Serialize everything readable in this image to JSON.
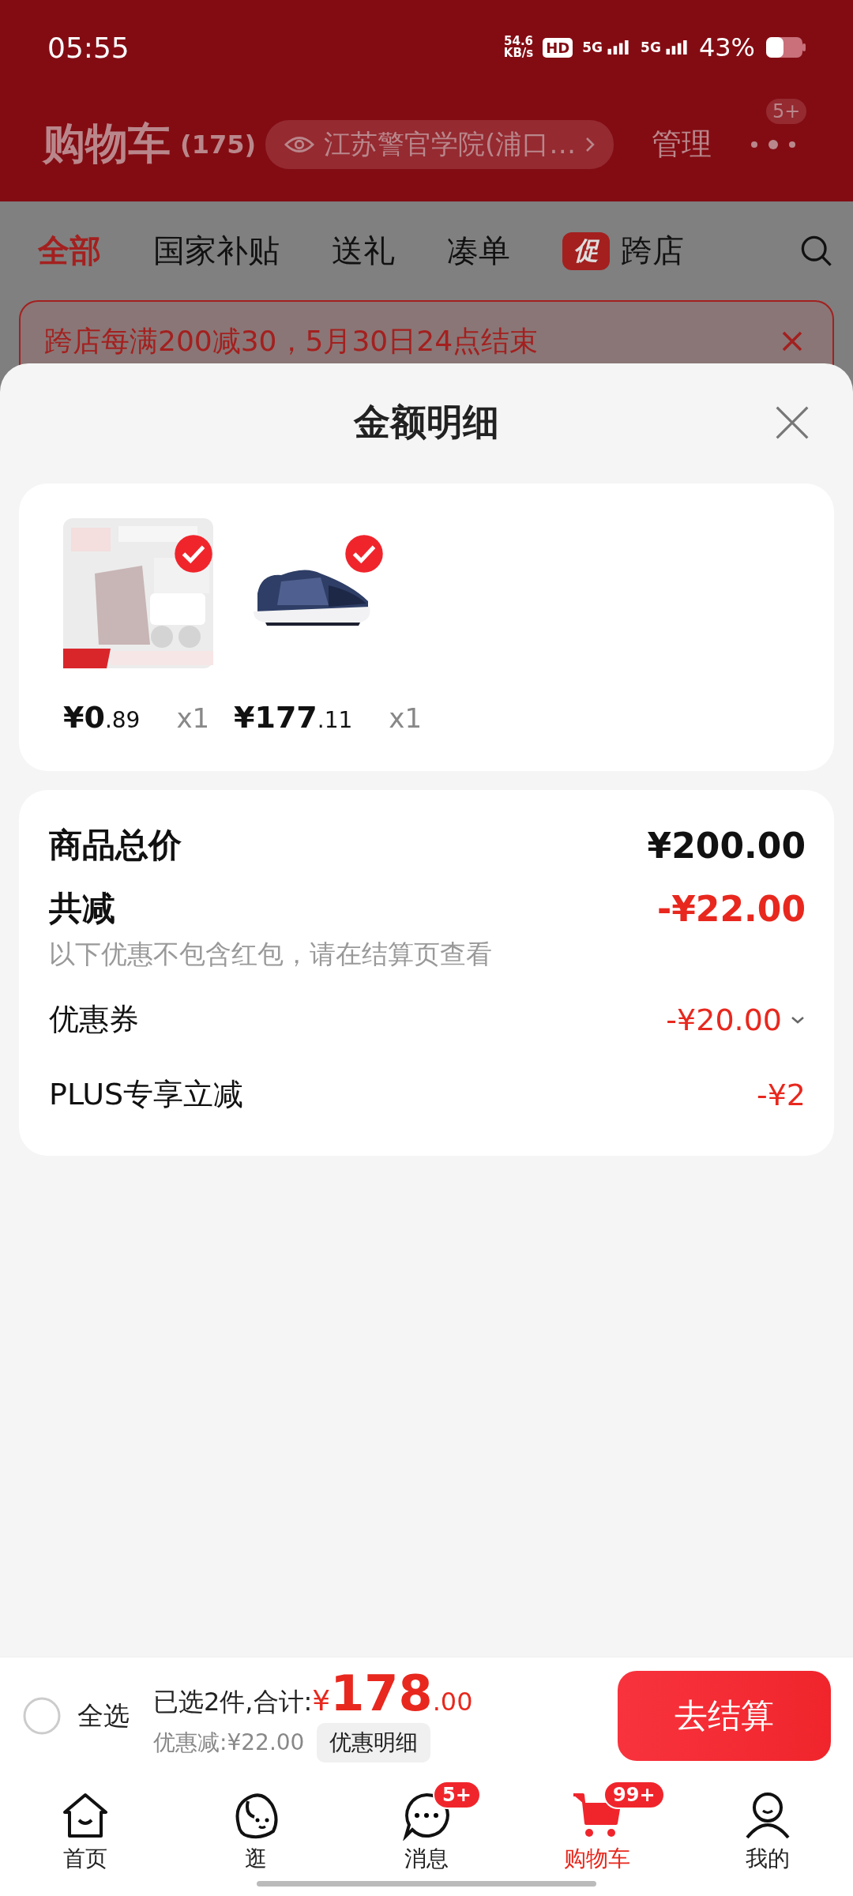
{
  "status_bar": {
    "time": "05:55",
    "net_speed": "54.6",
    "net_unit": "KB/s",
    "hd": "HD",
    "signals": [
      "5G",
      "5G"
    ],
    "battery": "43%"
  },
  "header": {
    "title": "购物车",
    "count": "(175)",
    "address": "江苏警官学院(浦口…",
    "manage": "管理",
    "more_badge": "5+"
  },
  "tabs": [
    {
      "label": "全部",
      "selected": true
    },
    {
      "label": "国家补贴",
      "selected": false
    },
    {
      "label": "送礼",
      "selected": false
    },
    {
      "label": "凑单",
      "selected": false
    },
    {
      "label": "跨店",
      "tag": "促",
      "selected": false
    }
  ],
  "banner": {
    "text": "跨店每满200减30，5月30日24点结束"
  },
  "sheet": {
    "title": "金额明细",
    "products": [
      {
        "kind": "pouch",
        "price": "¥0",
        "price_decimals": ".89",
        "quantity": "x1",
        "selected": true
      },
      {
        "kind": "shoe",
        "price": "¥177",
        "price_decimals": ".11",
        "quantity": "x1",
        "selected": true
      }
    ],
    "summary": [
      {
        "kind": "total",
        "label": "商品总价",
        "value": "¥200.00"
      },
      {
        "kind": "discount",
        "label": "共减",
        "value": "-¥22.00",
        "note": "以下优惠不包含红包，请在结算页查看"
      },
      {
        "kind": "item",
        "label": "优惠券",
        "value": "-¥20.00",
        "expandable": true
      },
      {
        "kind": "item",
        "label": "PLUS专享立减",
        "value": "-¥2",
        "expandable": false
      }
    ]
  },
  "checkout_bar": {
    "select_all": {
      "label": "全选",
      "checked": false
    },
    "selected_text": "已选2件,合计:",
    "currency": "¥",
    "amount": "178",
    "amount_decimals": ".00",
    "discount": "优惠减:¥22.00",
    "detail_button": "优惠明细",
    "checkout_button": "去结算"
  },
  "bottom_nav": [
    {
      "kind": "home",
      "label": "首页",
      "selected": false
    },
    {
      "kind": "browse",
      "label": "逛",
      "selected": false
    },
    {
      "kind": "messages",
      "label": "消息",
      "badge": "5+",
      "selected": false
    },
    {
      "kind": "cart",
      "label": "购物车",
      "badge": "99+",
      "selected": true
    },
    {
      "kind": "profile",
      "label": "我的",
      "selected": false
    }
  ]
}
